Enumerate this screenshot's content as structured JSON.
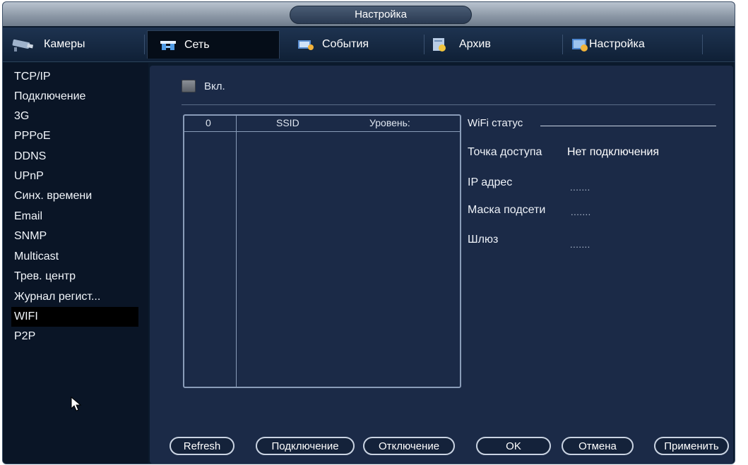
{
  "window": {
    "title": "Настройка"
  },
  "tabs": [
    {
      "label": "Камеры",
      "icon": "camera-icon"
    },
    {
      "label": "Сеть",
      "icon": "network-icon",
      "active": true
    },
    {
      "label": "События",
      "icon": "events-icon"
    },
    {
      "label": "Архив",
      "icon": "archive-icon"
    },
    {
      "label": "Настройка",
      "icon": "settings-icon"
    }
  ],
  "sidebar": {
    "items": [
      {
        "label": "TCP/IP"
      },
      {
        "label": "Подключение"
      },
      {
        "label": "3G"
      },
      {
        "label": "PPPoE"
      },
      {
        "label": "DDNS"
      },
      {
        "label": "UPnP"
      },
      {
        "label": "Синх. времени"
      },
      {
        "label": "Email"
      },
      {
        "label": "SNMP"
      },
      {
        "label": "Multicast"
      },
      {
        "label": "Трев. центр"
      },
      {
        "label": "Журнал регист..."
      },
      {
        "label": "WIFI",
        "active": true
      },
      {
        "label": "P2P"
      }
    ]
  },
  "wifi": {
    "enable_label": "Вкл.",
    "enabled": false,
    "list_headers": {
      "index": "0",
      "ssid": "SSID",
      "level": "Уровень:"
    },
    "status_title": "WiFi статус",
    "access_point_label": "Точка доступа",
    "access_point_value": "Нет подключения",
    "ip_label": "IP адрес",
    "ip_value": ".......",
    "mask_label": "Маска подсети",
    "mask_value": ".......",
    "gateway_label": "Шлюз",
    "gateway_value": "......."
  },
  "buttons": {
    "refresh": "Refresh",
    "connect": "Подключение",
    "disconnect": "Отключение",
    "ok": "OK",
    "cancel": "Отмена",
    "apply": "Применить"
  },
  "colors": {
    "accent": "#1b2a47",
    "active_item": "#000000"
  }
}
